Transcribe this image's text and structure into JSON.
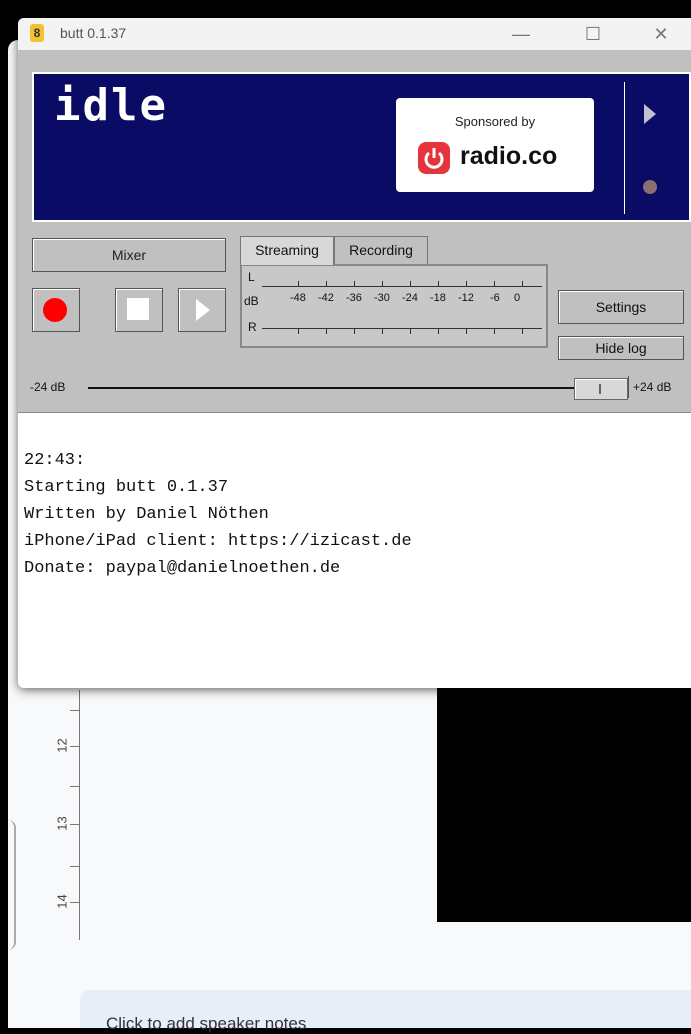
{
  "window": {
    "title": "butt 0.1.37",
    "minimize": "—",
    "maximize": "☐",
    "close": "✕"
  },
  "display": {
    "status": "idle",
    "sponsor_label": "Sponsored by",
    "sponsor_name": "radio.co"
  },
  "controls": {
    "mixer_label": "Mixer",
    "tabs": [
      "Streaming",
      "Recording"
    ],
    "settings_label": "Settings",
    "hide_log_label": "Hide log"
  },
  "vu_meter": {
    "left_label": "L",
    "db_label": "dB",
    "right_label": "R",
    "scale": [
      "-48",
      "-42",
      "-36",
      "-30",
      "-24",
      "-18",
      "-12",
      "-6",
      "0"
    ]
  },
  "gain": {
    "min_label": "-24 dB",
    "max_label": "+24 dB"
  },
  "log": {
    "lines": [
      "22:43:",
      "Starting butt 0.1.37",
      "Written by Daniel Nöthen",
      "iPhone/iPad client: https://izicast.de",
      "Donate: paypal@danielnoethen.de"
    ]
  },
  "background": {
    "ruler_numbers": [
      "12",
      "13",
      "14"
    ],
    "speaker_notes_placeholder": "Click to add speaker notes"
  },
  "colors": {
    "display_bg": "#0a0b65",
    "record_red": "#ff0000",
    "sponsor_red": "#e5343b"
  }
}
